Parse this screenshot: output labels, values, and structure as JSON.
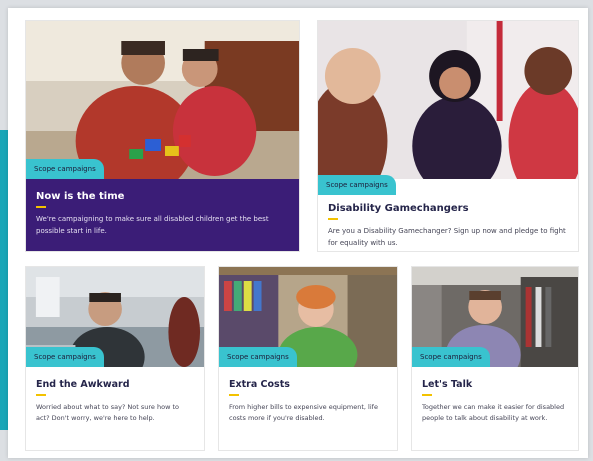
{
  "cards": [
    {
      "tag": "Scope campaigns",
      "title": "Now is the time",
      "description": "We're campaigning to make sure all disabled children get the best possible start in life."
    },
    {
      "tag": "Scope campaigns",
      "title": "Disability Gamechangers",
      "description": "Are you a Disability Gamechanger? Sign up now and pledge to fight for equality with us."
    },
    {
      "tag": "Scope campaigns",
      "title": "End the Awkward",
      "description": "Worried about what to say? Not sure how to act? Don't worry, we're here to help."
    },
    {
      "tag": "Scope campaigns",
      "title": "Extra Costs",
      "description": "From higher bills to expensive equipment, life costs more if you're disabled."
    },
    {
      "tag": "Scope campaigns",
      "title": "Let's Talk",
      "description": "Together we can make it easier for disabled people to talk about disability at work."
    }
  ],
  "colors": {
    "brand_purple": "#3b1d77",
    "tag_teal": "#39c3cf",
    "accent_yellow": "#f3c200",
    "side_teal": "#1aa6b7"
  }
}
